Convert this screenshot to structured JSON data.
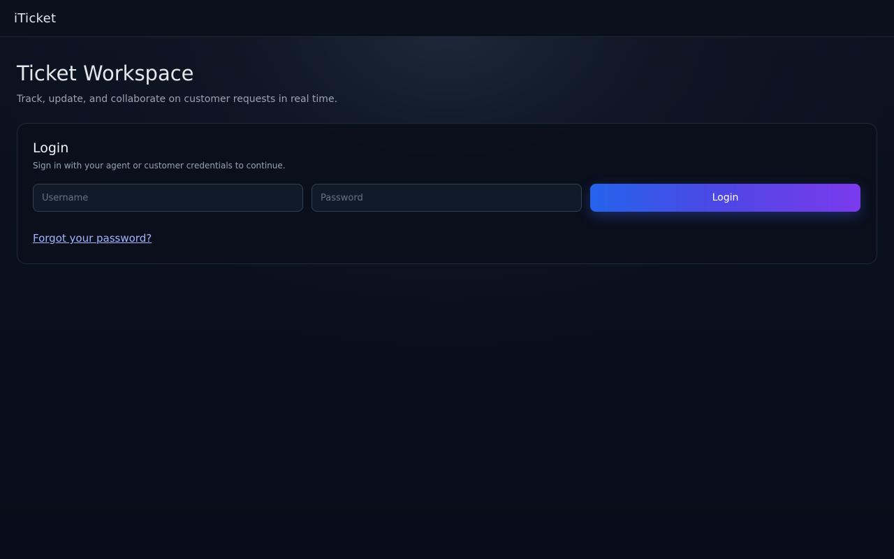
{
  "app": {
    "brand": "iTicket"
  },
  "page": {
    "title": "Ticket Workspace",
    "subtitle": "Track, update, and collaborate on customer requests in real time."
  },
  "login": {
    "title": "Login",
    "subtitle": "Sign in with your agent or customer credentials to continue.",
    "username_value": "",
    "username_placeholder": "Username",
    "password_value": "",
    "password_placeholder": "Password",
    "submit_label": "Login",
    "forgot_label": "Forgot your password?"
  },
  "colors": {
    "background": "#070d1a",
    "accent_start": "#2563eb",
    "accent_end": "#7c3aed",
    "link": "#a5b4fc"
  }
}
